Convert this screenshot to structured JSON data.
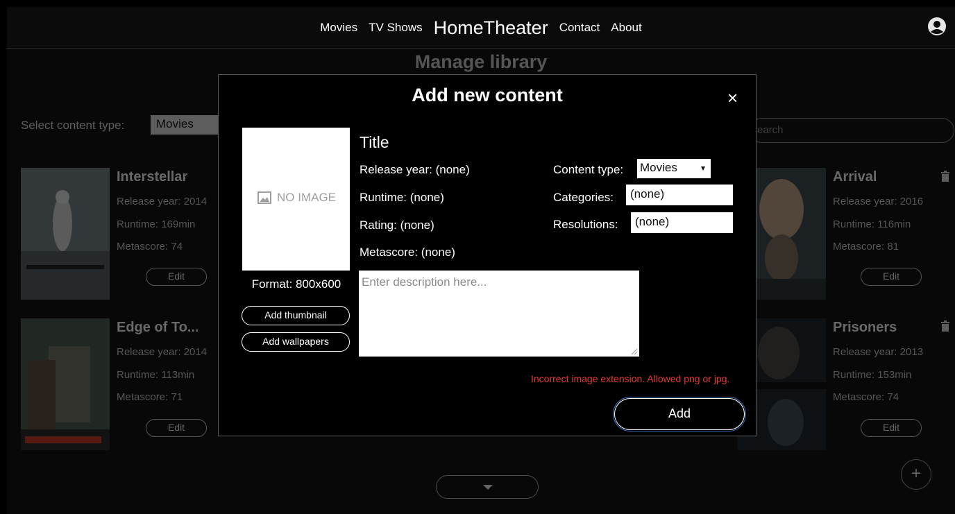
{
  "nav": {
    "links": [
      "Movies",
      "TV Shows"
    ],
    "brand": "HomeTheater",
    "links_right": [
      "Contact",
      "About"
    ]
  },
  "page": {
    "title": "Manage library",
    "select_label": "Select content type:",
    "select_value": "Movies",
    "search_placeholder": "Search",
    "search_visible": "earch",
    "cards_left": [
      {
        "title": "Interstellar",
        "release": "Release year: 2014",
        "runtime": "Runtime: 169min",
        "metascore": "Metascore: 74",
        "edit": "Edit"
      },
      {
        "title": "Edge of To...",
        "release": "Release year: 2014",
        "runtime": "Runtime: 113min",
        "metascore": "Metascore: 71",
        "edit": "Edit"
      }
    ],
    "cards_right": [
      {
        "title": "Arrival",
        "release": "Release year: 2016",
        "runtime": "Runtime: 116min",
        "metascore": "Metascore: 81",
        "edit": "Edit"
      },
      {
        "title": "Prisoners",
        "release": "Release year: 2013",
        "runtime": "Runtime: 153min",
        "metascore": "Metascore: 74",
        "edit": "Edit"
      }
    ],
    "add_button": "+"
  },
  "modal": {
    "title": "Add new content",
    "close": "×",
    "no_image": "NO IMAGE",
    "format": "Format: 800x600",
    "add_thumbnail": "Add thumbnail",
    "add_wallpapers": "Add wallpapers",
    "field_title": "Title",
    "release_year": "Release year:  (none)",
    "runtime": "Runtime:  (none)",
    "rating": "Rating:  (none)",
    "metascore": "Metascore:  (none)",
    "content_type_label": "Content type:",
    "content_type_value": "Movies",
    "categories_label": "Categories:",
    "categories_value": "(none)",
    "resolutions_label": "Resolutions:",
    "resolutions_value": "(none)",
    "description_placeholder": "Enter description here...",
    "error": "Incorrect image extension. Allowed png or jpg.",
    "add": "Add"
  },
  "colors": {
    "error": "#e53935",
    "focus_outline": "#3b6fc2"
  }
}
